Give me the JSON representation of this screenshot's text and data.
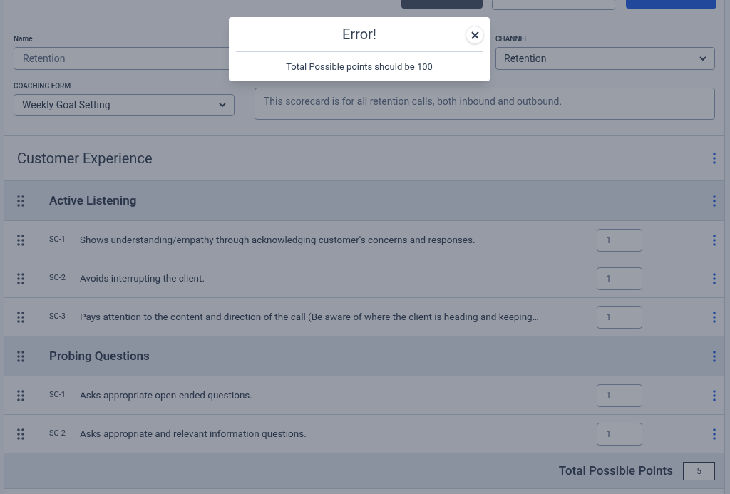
{
  "form": {
    "name": {
      "label": "Name",
      "value": "Retention"
    },
    "channel": {
      "label": "CHANNEL",
      "value": "Retention"
    },
    "coaching_form": {
      "label": "COACHING FORM",
      "value": "Weekly Goal Setting"
    },
    "description": {
      "value": "This scorecard is for all retention calls, both inbound and outbound."
    }
  },
  "section": {
    "title": "Customer Experience"
  },
  "groups": [
    {
      "title": "Active Listening",
      "items": [
        {
          "code": "SC-1",
          "text": "Shows understanding/empathy through acknowledging customer's concerns and responses.",
          "points": "1"
        },
        {
          "code": "SC-2",
          "text": "Avoids interrupting the client.",
          "points": "1"
        },
        {
          "code": "SC-3",
          "text": "Pays attention to the content and direction of the call (Be aware of where the client is heading and keeping…",
          "points": "1"
        }
      ]
    },
    {
      "title": "Probing Questions",
      "items": [
        {
          "code": "SC-1",
          "text": "Asks appropriate open-ended questions.",
          "points": "1"
        },
        {
          "code": "SC-2",
          "text": "Asks appropriate and relevant information questions.",
          "points": "1"
        }
      ]
    }
  ],
  "total": {
    "label": "Total Possible Points",
    "value": "5"
  },
  "dialog": {
    "title": "Error!",
    "message": "Total Possible points should be 100"
  }
}
